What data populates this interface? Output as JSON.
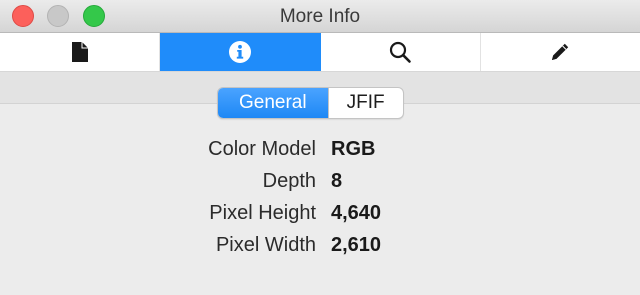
{
  "window": {
    "title": "More Info"
  },
  "toolbar": {
    "tabs": [
      {
        "icon": "document-icon",
        "active": false
      },
      {
        "icon": "info-icon",
        "active": true
      },
      {
        "icon": "search-icon",
        "active": false
      },
      {
        "icon": "pencil-icon",
        "active": false
      }
    ]
  },
  "segmented": {
    "items": [
      {
        "label": "General",
        "active": true
      },
      {
        "label": "JFIF",
        "active": false
      }
    ]
  },
  "info": {
    "rows": [
      {
        "label": "Color Model",
        "value": "RGB"
      },
      {
        "label": "Depth",
        "value": "8"
      },
      {
        "label": "Pixel Height",
        "value": "4,640"
      },
      {
        "label": "Pixel Width",
        "value": "2,610"
      }
    ]
  },
  "colors": {
    "accent": "#1f8cfa",
    "close": "#fc605b",
    "zoom": "#34c84a",
    "minimize_inactive": "#c8c8c8"
  }
}
